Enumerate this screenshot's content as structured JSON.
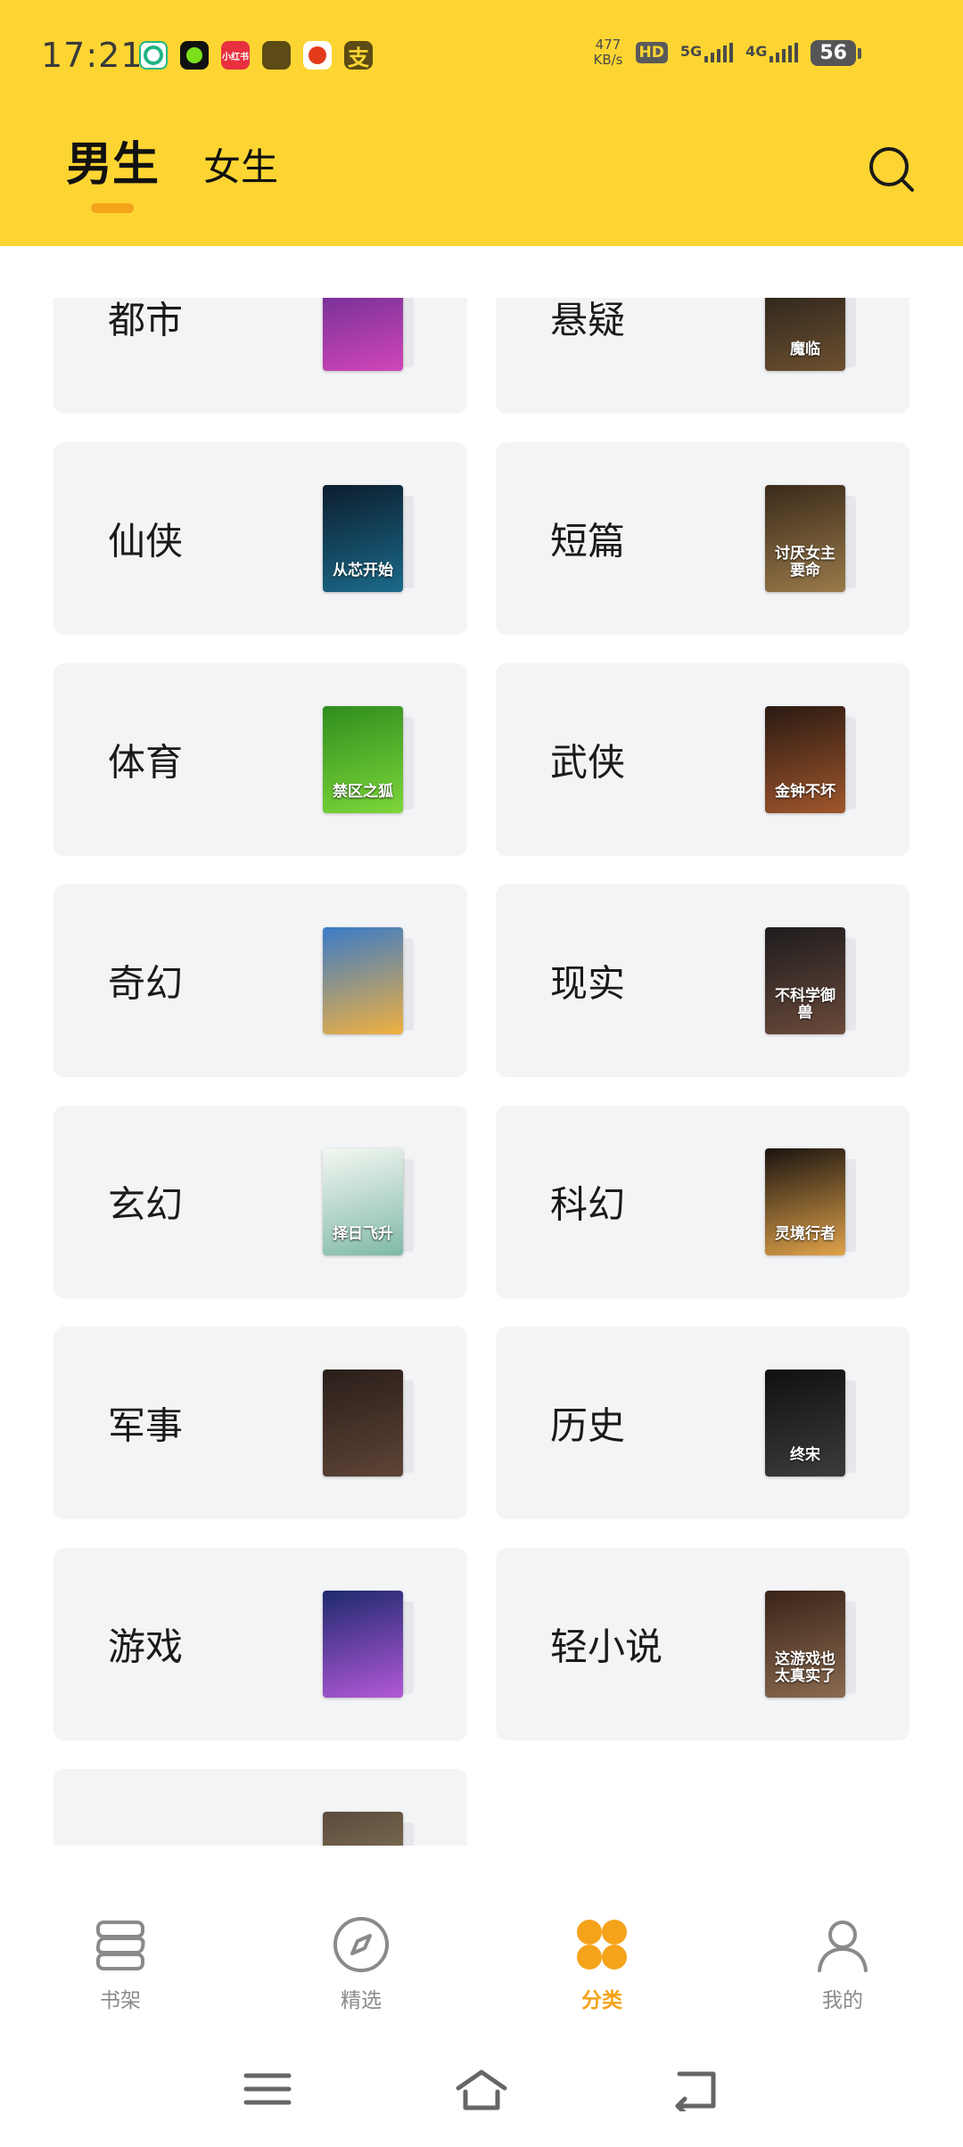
{
  "status_bar": {
    "time": "17:21",
    "net_speed_value": "477",
    "net_speed_unit": "KB/s",
    "hd_label": "HD",
    "sim1_label": "5G",
    "sim2_label": "4G",
    "battery": "56",
    "notif_app_red_label": "小红书",
    "notif_app_pay_label": "支"
  },
  "header": {
    "tabs": [
      {
        "label": "男生",
        "active": true
      },
      {
        "label": "女生",
        "active": false
      }
    ],
    "accent_color": "#FDD532",
    "indicator_color": "#F5A31A"
  },
  "categories": [
    {
      "name": "都市",
      "cover_text": "",
      "cover_colors": [
        "#5B2A8E",
        "#D146B8"
      ]
    },
    {
      "name": "悬疑",
      "cover_text": "魔临",
      "cover_colors": [
        "#1C1A17",
        "#6D5030"
      ]
    },
    {
      "name": "仙侠",
      "cover_text": "从芯开始",
      "cover_colors": [
        "#0C1E2E",
        "#1B6A8A"
      ]
    },
    {
      "name": "短篇",
      "cover_text": "讨厌女主 要命",
      "cover_colors": [
        "#3A2A1A",
        "#9A7A4A"
      ]
    },
    {
      "name": "体育",
      "cover_text": "禁区之狐",
      "cover_colors": [
        "#2F8E1E",
        "#7DD63A"
      ]
    },
    {
      "name": "武侠",
      "cover_text": "金钟不坏",
      "cover_colors": [
        "#2A1A12",
        "#A0562C"
      ]
    },
    {
      "name": "奇幻",
      "cover_text": "",
      "cover_colors": [
        "#3A7BC8",
        "#F0B040"
      ]
    },
    {
      "name": "现实",
      "cover_text": "不科学御兽",
      "cover_colors": [
        "#1E1C1E",
        "#6A4A3A"
      ]
    },
    {
      "name": "玄幻",
      "cover_text": "择日飞升",
      "cover_colors": [
        "#F4F7F2",
        "#7FB9A8"
      ]
    },
    {
      "name": "科幻",
      "cover_text": "灵境行者",
      "cover_colors": [
        "#1A1410",
        "#E0A24A"
      ]
    },
    {
      "name": "军事",
      "cover_text": "",
      "cover_colors": [
        "#2A1E1A",
        "#5E4436"
      ]
    },
    {
      "name": "历史",
      "cover_text": "终宋",
      "cover_colors": [
        "#101010",
        "#3C3C3C"
      ]
    },
    {
      "name": "游戏",
      "cover_text": "",
      "cover_colors": [
        "#1E2A6E",
        "#B258D8"
      ]
    },
    {
      "name": "轻小说",
      "cover_text": "这游戏也太真实了",
      "cover_colors": [
        "#3A2418",
        "#8A6A50"
      ]
    },
    {
      "name": "",
      "cover_text": "",
      "cover_colors": [
        "#5A4A3A",
        "#9A8A6A"
      ]
    }
  ],
  "bottom_nav": [
    {
      "label": "书架",
      "icon": "bookshelf-icon",
      "active": false
    },
    {
      "label": "精选",
      "icon": "compass-icon",
      "active": false
    },
    {
      "label": "分类",
      "icon": "category-icon",
      "active": true
    },
    {
      "label": "我的",
      "icon": "profile-icon",
      "active": false
    }
  ]
}
